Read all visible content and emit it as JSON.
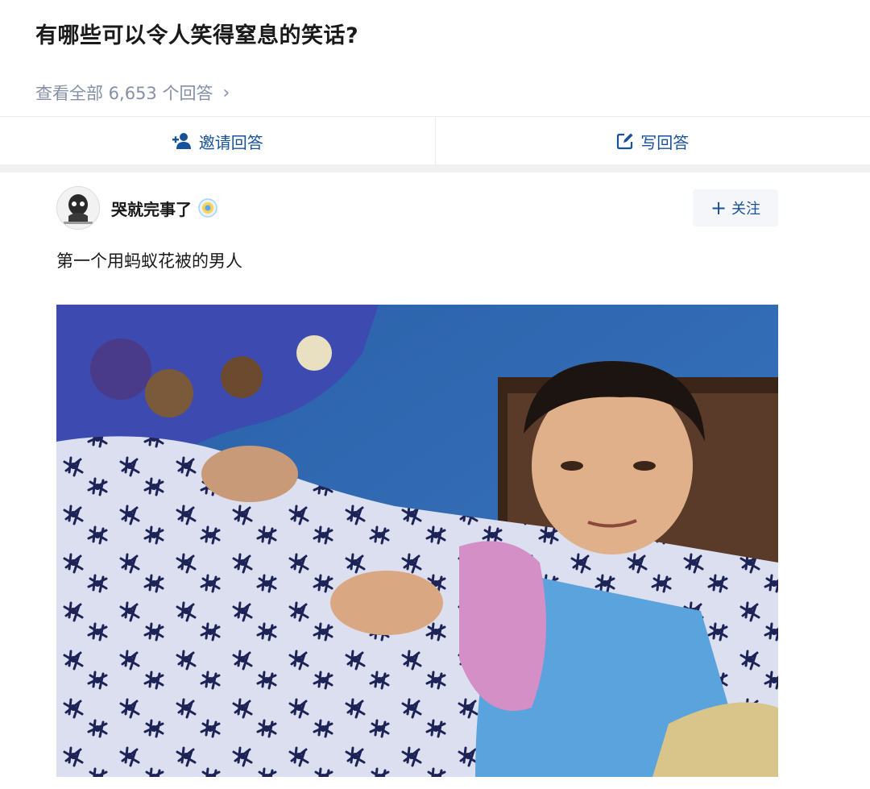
{
  "question": {
    "title": "有哪些可以令人笑得窒息的笑话?",
    "view_all_label": "查看全部 6,653 个回答",
    "view_all_chevron": "›"
  },
  "actions": {
    "invite_label": "邀请回答",
    "write_label": "写回答"
  },
  "answer": {
    "author_name": "哭就完事了",
    "follow_label": "关注",
    "follow_plus": "+",
    "text": "第一个用蚂蚁花被的男人",
    "image_alt": "boy lying in bed under an ant-pattern quilt"
  },
  "colors": {
    "link_blue": "#175199",
    "muted_gray": "#8590a6",
    "wall_blue": "#2f68b3",
    "quilt_white": "#dcdff0",
    "pajama_blue": "#5ba3dc",
    "pink_cloth": "#d58fc7"
  },
  "icons": {
    "invite": "add-user-icon",
    "write": "edit-icon",
    "badge": "verified-badge-icon",
    "chevron": "chevron-right-icon"
  }
}
